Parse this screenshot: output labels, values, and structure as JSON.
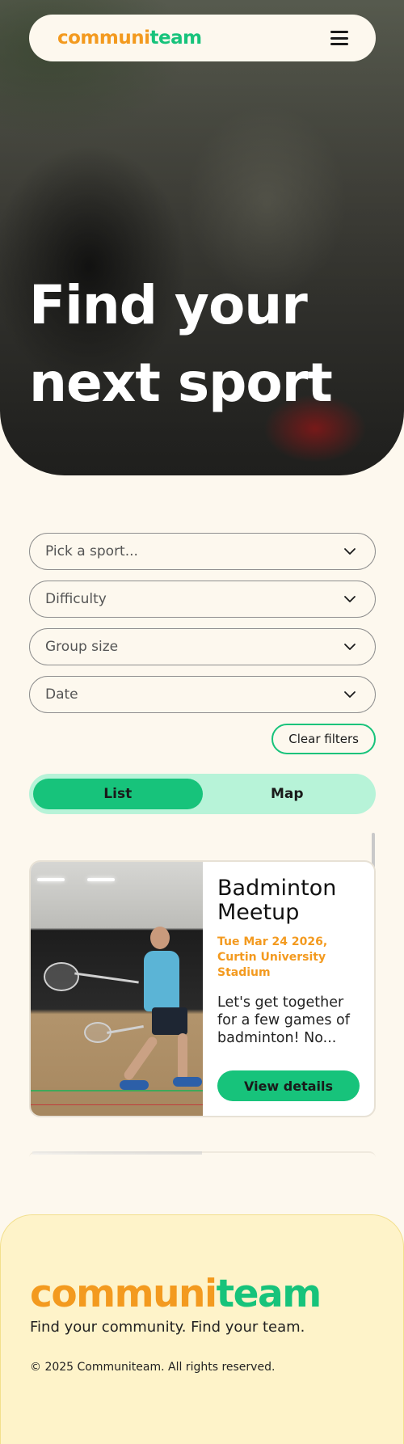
{
  "brand": {
    "part1": "communi",
    "part2": "team",
    "color_orange": "#f39a1f",
    "color_green": "#17c37b"
  },
  "nav": {
    "menu_icon": "hamburger-icon"
  },
  "hero": {
    "line1": "Find your",
    "line2": "next sport"
  },
  "filters": {
    "sport_placeholder": "Pick a sport...",
    "difficulty_placeholder": "Difficulty",
    "group_size_placeholder": "Group size",
    "date_placeholder": "Date",
    "clear_label": "Clear filters",
    "chevron_icon": "chevron-down-icon"
  },
  "view_toggle": {
    "list_label": "List",
    "map_label": "Map",
    "selected": "List"
  },
  "events": [
    {
      "title": "Badminton Meetup",
      "date_location": "Tue Mar 24 2026, Curtin University Stadium",
      "description": "Let's get together for a few games of badminton! No...",
      "button_label": "View details"
    }
  ],
  "footer": {
    "tagline": "Find your community. Find your team.",
    "copyright": "© 2025 Communiteam. All rights reserved."
  }
}
